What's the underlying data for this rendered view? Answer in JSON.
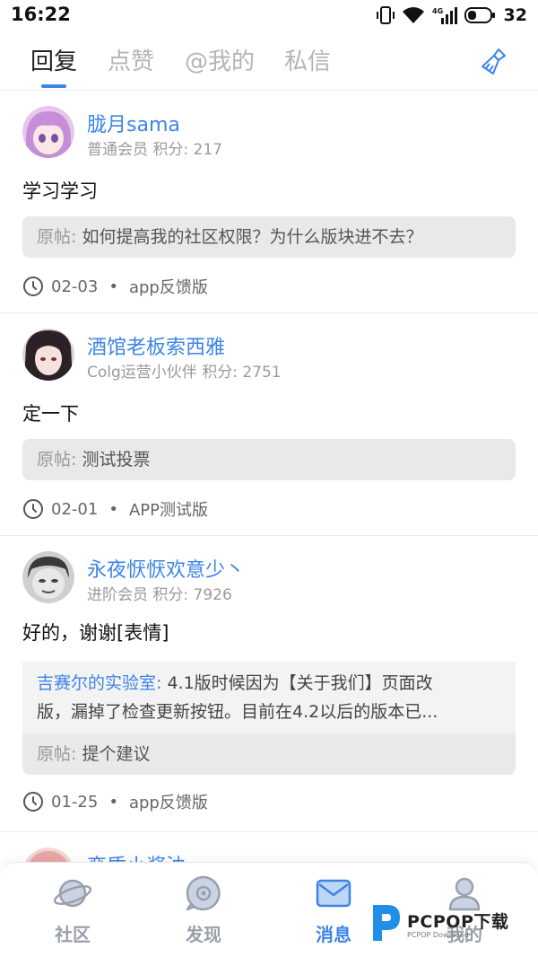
{
  "status_bar": {
    "time": "16:22",
    "network": "4G",
    "battery": "32"
  },
  "tabs": [
    {
      "label": "回复",
      "active": true
    },
    {
      "label": "点赞",
      "active": false
    },
    {
      "label": "@我的",
      "active": false
    },
    {
      "label": "私信",
      "active": false
    }
  ],
  "toolbar": {
    "clean_icon": "broom-icon"
  },
  "feed": [
    {
      "username": "胧月sama",
      "rank": "普通会员",
      "points_label": "积分: 217",
      "content": "学习学习",
      "original_label": "原帖:",
      "original_title": "如何提高我的社区权限？为什么版块进不去？",
      "date": "02-03",
      "board": "app反馈版"
    },
    {
      "username": "酒馆老板索西雅",
      "rank": "Colg运营小伙伴",
      "points_label": "积分: 2751",
      "content": "定一下",
      "original_label": "原帖:",
      "original_title": "测试投票",
      "date": "02-01",
      "board": "APP测试版"
    },
    {
      "username": "永夜恹恹欢意少丶",
      "rank": "进阶会员",
      "points_label": "积分: 7926",
      "content": "好的，谢谢[表情]",
      "reply_author": "吉赛尔的实验室:",
      "reply_line1": "4.1版时候因为【关于我们】页面改",
      "reply_line2": "版，漏掉了检查更新按钮。目前在4.2以后的版本已...",
      "original_label": "原帖:",
      "original_title": "提个建议",
      "date": "01-25",
      "board": "app反馈版"
    },
    {
      "username": "变质小酱油"
    }
  ],
  "bottom_nav": [
    {
      "label": "社区",
      "icon": "planet-icon",
      "active": false
    },
    {
      "label": "发现",
      "icon": "discover-icon",
      "active": false
    },
    {
      "label": "消息",
      "icon": "mail-icon",
      "active": true
    },
    {
      "label": "我的",
      "icon": "user-icon",
      "active": false
    }
  ],
  "watermark": {
    "title": "PCPOP下载",
    "subtitle": "PCPOP Download"
  },
  "colors": {
    "accent": "#3c84e6",
    "muted": "#9a9a9a",
    "quote_bg": "#f0f0f0"
  }
}
